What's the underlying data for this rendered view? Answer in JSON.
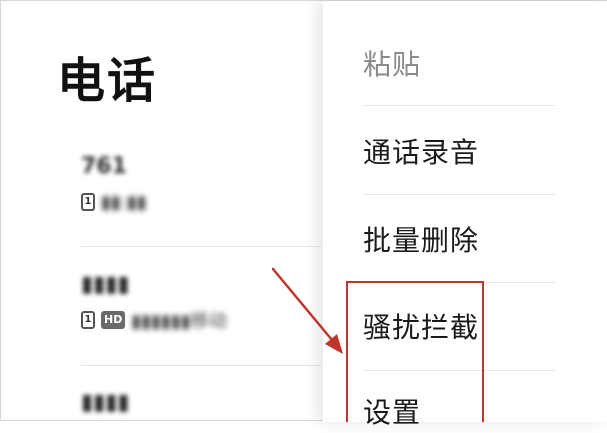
{
  "page": {
    "title": "电话"
  },
  "call_log": [
    {
      "name": "761",
      "sim": "1",
      "hd": false,
      "detail": "▮▮:▮▮"
    },
    {
      "name": "▮▮▮▮",
      "sim": "1",
      "hd": true,
      "hd_label": "HD",
      "detail": "▮▮▮▮▮▮移动"
    },
    {
      "name": "▮▮▮▮",
      "sim": "",
      "hd": false,
      "detail": ""
    }
  ],
  "menu": {
    "items": [
      {
        "label": "粘贴",
        "muted": true
      },
      {
        "label": "通话录音"
      },
      {
        "label": "批量删除"
      },
      {
        "label": "骚扰拦截",
        "highlighted": true
      },
      {
        "label": "设置"
      }
    ]
  },
  "annotation": {
    "color": "#c0352b"
  }
}
